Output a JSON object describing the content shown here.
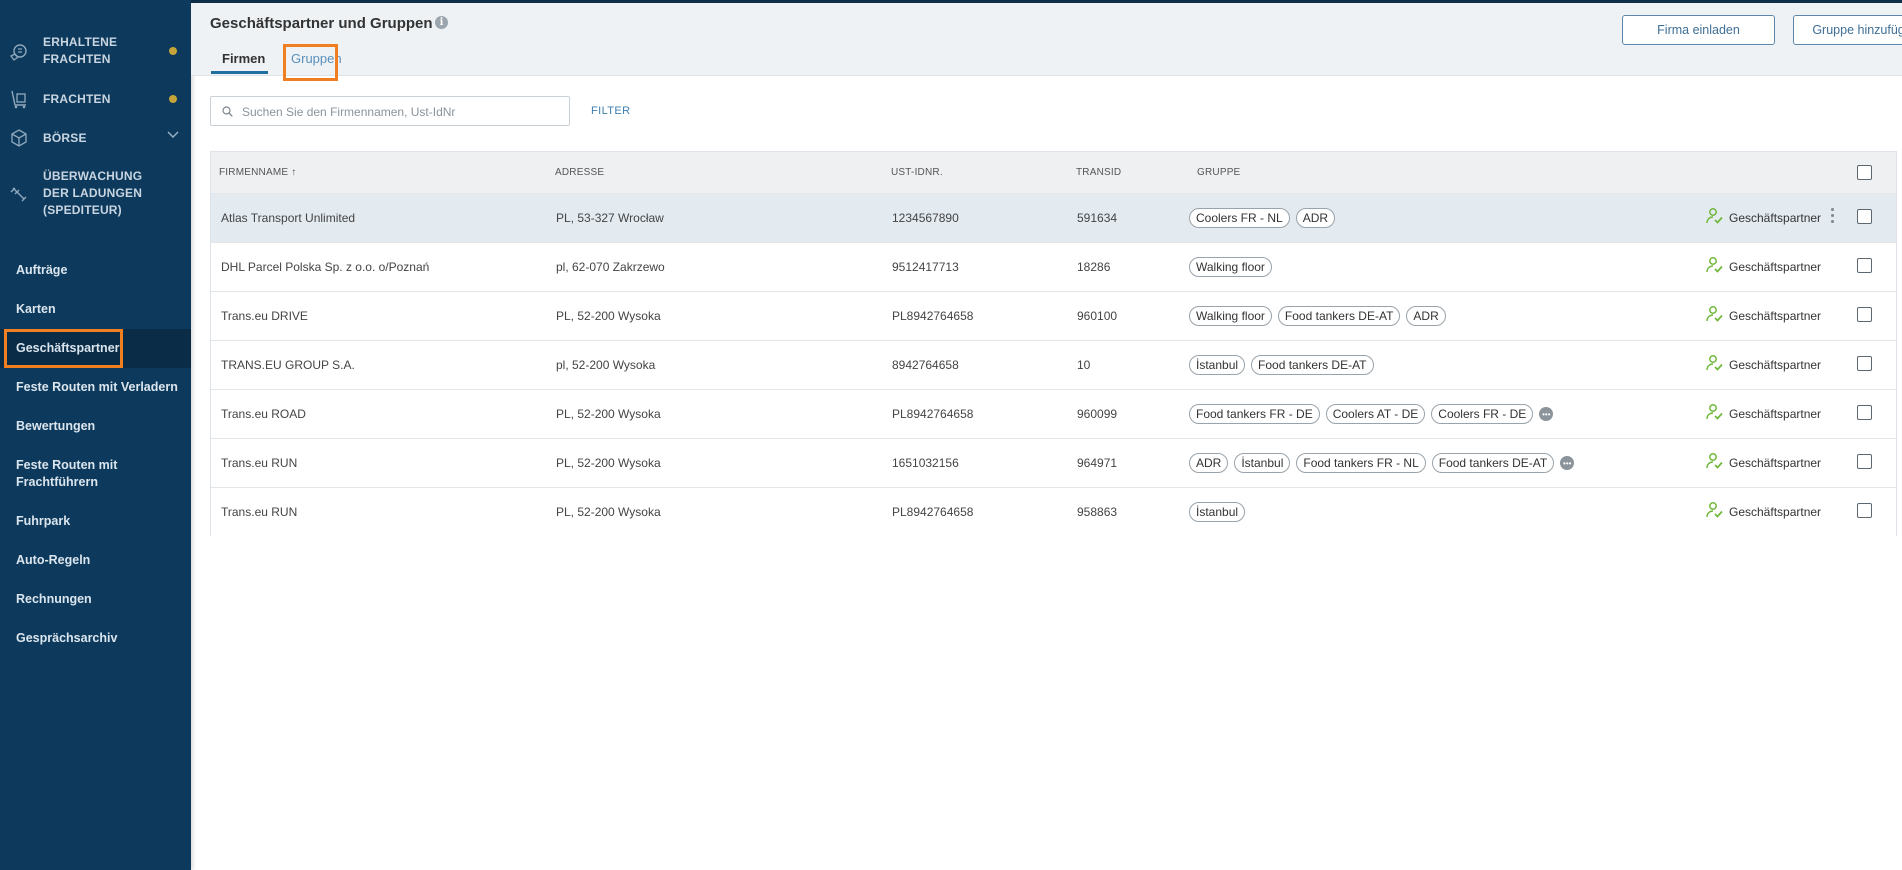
{
  "sidebar": {
    "top_items": [
      {
        "label": "ERHALTENE FRACHTEN",
        "icon": "received-freight-icon",
        "has_dot": true
      },
      {
        "label": "FRACHTEN",
        "icon": "freight-icon",
        "has_dot": true
      },
      {
        "label": "BÖRSE",
        "icon": "exchange-box-icon",
        "has_chevron": true
      },
      {
        "label": "ÜBERWACHUNG DER LADUNGEN (SPEDITEUR)",
        "icon": "satellite-icon"
      }
    ],
    "links": [
      "Aufträge",
      "Karten",
      "Geschäftspartner",
      "Feste Routen mit Verladern",
      "Bewertungen",
      "Feste Routen mit Frachtführern",
      "Fuhrpark",
      "Auto-Regeln",
      "Rechnungen",
      "Gesprächsarchiv"
    ],
    "active_link": "Geschäftspartner",
    "dot_color": "#c6a43a",
    "background": "#0d3a5c"
  },
  "header": {
    "title": "Geschäftspartner und Gruppen",
    "tabs": [
      {
        "label": "Firmen",
        "active": true
      },
      {
        "label": "Gruppen",
        "active": false
      }
    ],
    "buttons": {
      "invite": "Firma einladen",
      "add_group": "Gruppe hinzufügen"
    }
  },
  "search": {
    "placeholder": "Suchen Sie den Firmennamen, Ust-IdNr",
    "value": "",
    "filter_label": "FILTER"
  },
  "table": {
    "columns": {
      "name": "FIRMENNAME ↑",
      "address": "ADRESSE",
      "vat": "UST-IDNR.",
      "transid": "TRANSID",
      "group": "GRUPPE"
    },
    "rows": [
      {
        "name": "Atlas Transport Unlimited",
        "address": "PL, 53-327 Wrocław",
        "vat": "1234567890",
        "transid": "591634",
        "groups": [
          "Coolers FR - NL",
          "ADR"
        ],
        "more": false,
        "partner": "Geschäftspartner"
      },
      {
        "name": "DHL Parcel Polska Sp. z o.o. o/Poznań",
        "address": "pl, 62-070 Zakrzewo",
        "vat": "9512417713",
        "transid": "18286",
        "groups": [
          "Walking floor"
        ],
        "more": false,
        "partner": "Geschäftspartner"
      },
      {
        "name": "Trans.eu DRIVE",
        "address": "PL, 52-200 Wysoka",
        "vat": "PL8942764658",
        "transid": "960100",
        "groups": [
          "Walking floor",
          "Food tankers DE-AT",
          "ADR"
        ],
        "more": false,
        "partner": "Geschäftspartner"
      },
      {
        "name": "TRANS.EU GROUP S.A.",
        "address": "pl, 52-200 Wysoka",
        "vat": "8942764658",
        "transid": "10",
        "groups": [
          "İstanbul",
          "Food tankers DE-AT"
        ],
        "more": false,
        "partner": "Geschäftspartner"
      },
      {
        "name": "Trans.eu ROAD",
        "address": "PL, 52-200 Wysoka",
        "vat": "PL8942764658",
        "transid": "960099",
        "groups": [
          "Food tankers FR - DE",
          "Coolers AT - DE",
          "Coolers FR - DE"
        ],
        "more": true,
        "partner": "Geschäftspartner"
      },
      {
        "name": "Trans.eu RUN",
        "address": "PL, 52-200 Wysoka",
        "vat": "1651032156",
        "transid": "964971",
        "groups": [
          "ADR",
          "İstanbul",
          "Food tankers FR - NL",
          "Food tankers DE-AT"
        ],
        "more": true,
        "partner": "Geschäftspartner"
      },
      {
        "name": "Trans.eu RUN",
        "address": "PL, 52-200 Wysoka",
        "vat": "PL8942764658",
        "transid": "958863",
        "groups": [
          "İstanbul"
        ],
        "more": false,
        "partner": "Geschäftspartner"
      }
    ]
  },
  "colors": {
    "accent": "#1f6fa0",
    "highlight_box": "#f07f22",
    "partner_icon": "#6fb83a",
    "row_highlight": "#e3eaf0"
  }
}
